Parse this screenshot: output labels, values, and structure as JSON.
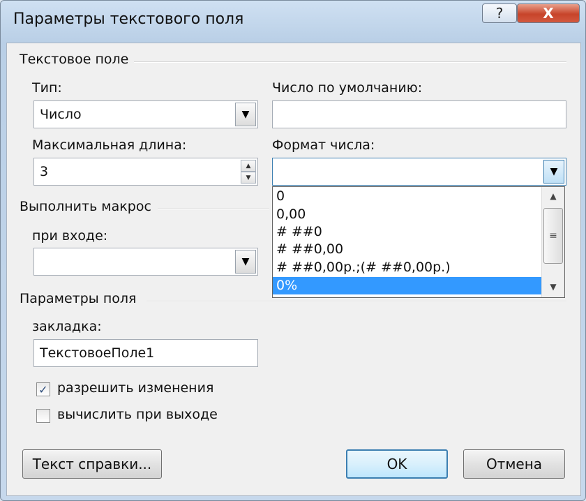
{
  "window": {
    "title": "Параметры текстового поля",
    "help": "?",
    "close": "X"
  },
  "textfield_group": {
    "label": "Текстовое поле"
  },
  "type": {
    "label": "Тип:",
    "value": "Число"
  },
  "default_number": {
    "label": "Число по умолчанию:",
    "value": ""
  },
  "max_length": {
    "label": "Максимальная длина:",
    "value": "3"
  },
  "number_format": {
    "label": "Формат числа:",
    "value": "",
    "options": [
      "0",
      "0,00",
      "# ##0",
      "# ##0,00",
      "# ##0,00р.;(# ##0,00р.)",
      "0%"
    ],
    "selected_index": 5
  },
  "macro_group": {
    "label": "Выполнить макрос"
  },
  "on_entry": {
    "label": "при входе:",
    "value": ""
  },
  "field_params_group": {
    "label": "Параметры поля"
  },
  "bookmark": {
    "label": "закладка:",
    "value": "ТекстовоеПоле1"
  },
  "allow_changes": {
    "label": "разрешить изменения",
    "checked": true
  },
  "calc_on_exit": {
    "label": "вычислить при выходе",
    "checked": false
  },
  "buttons": {
    "help_text": "Текст справки...",
    "ok": "OK",
    "cancel": "Отмена"
  },
  "icons": {
    "dropdown": "chevron-down-icon",
    "spin_up": "spin-up-icon",
    "spin_down": "spin-down-icon",
    "check": "check-icon"
  }
}
